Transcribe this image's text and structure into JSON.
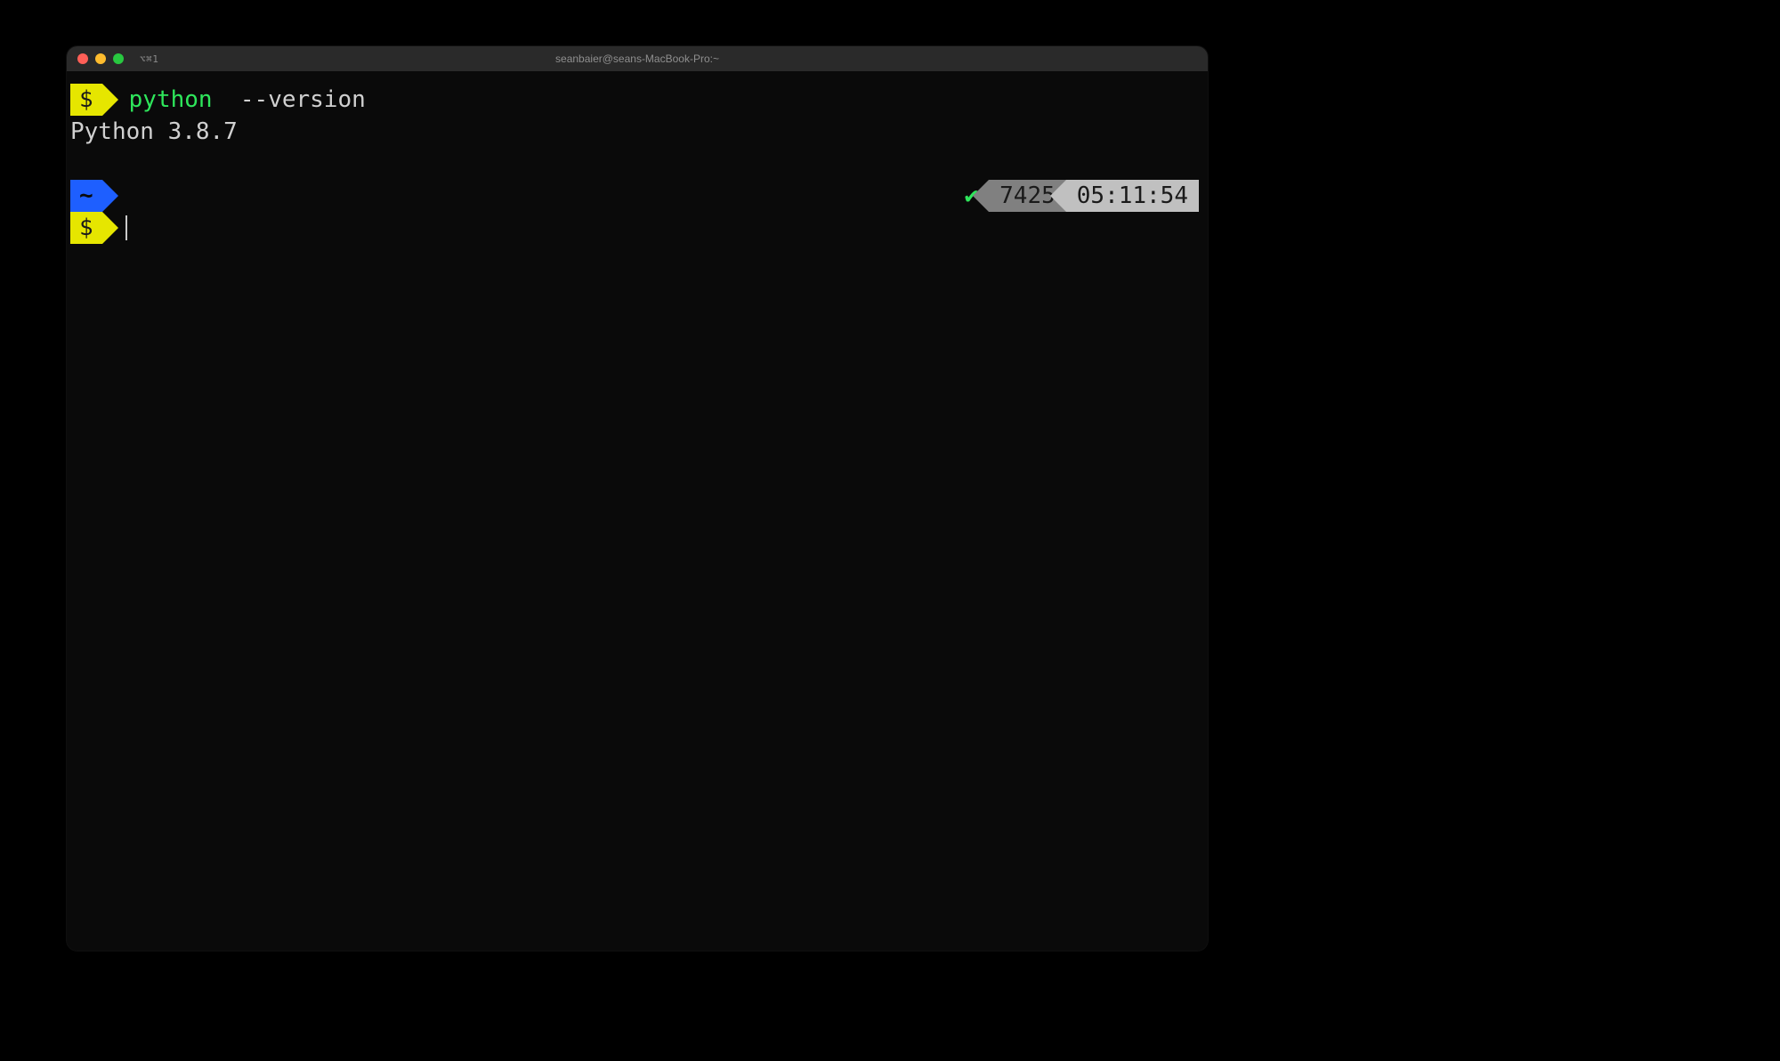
{
  "titlebar": {
    "tab_label": "⌥⌘1",
    "window_title": "seanbaier@seans-MacBook-Pro:~"
  },
  "prompt": {
    "dollar": "$",
    "tilde": "~"
  },
  "history": {
    "command_program": "python",
    "command_arg": "--version",
    "output": "Python 3.8.7"
  },
  "right_status": {
    "check_icon": "✔",
    "history_number": "7425",
    "time": "05:11:54"
  }
}
